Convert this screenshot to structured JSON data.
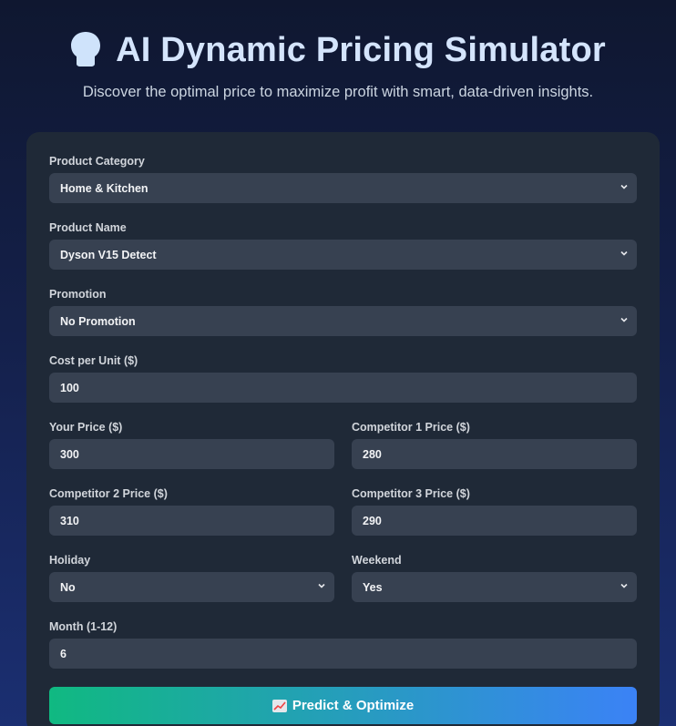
{
  "header": {
    "title": "AI Dynamic Pricing Simulator",
    "subtitle": "Discover the optimal price to maximize profit with smart, data-driven insights."
  },
  "form": {
    "category": {
      "label": "Product Category",
      "value": "Home & Kitchen"
    },
    "product_name": {
      "label": "Product Name",
      "value": "Dyson V15 Detect"
    },
    "promotion": {
      "label": "Promotion",
      "value": "No Promotion"
    },
    "cost": {
      "label": "Cost per Unit ($)",
      "value": "100"
    },
    "your_price": {
      "label": "Your Price ($)",
      "value": "300"
    },
    "comp1": {
      "label": "Competitor 1 Price ($)",
      "value": "280"
    },
    "comp2": {
      "label": "Competitor 2 Price ($)",
      "value": "310"
    },
    "comp3": {
      "label": "Competitor 3 Price ($)",
      "value": "290"
    },
    "holiday": {
      "label": "Holiday",
      "value": "No"
    },
    "weekend": {
      "label": "Weekend",
      "value": "Yes"
    },
    "month": {
      "label": "Month (1-12)",
      "value": "6"
    }
  },
  "cta": {
    "label": "Predict & Optimize"
  },
  "icons": {
    "title": "brain-icon",
    "cta": "chart-increasing-icon"
  },
  "colors": {
    "title": "#d4e4fc",
    "card": "#1f2937",
    "field": "#374151",
    "cta_start": "#10b981",
    "cta_end": "#3b82f6"
  }
}
